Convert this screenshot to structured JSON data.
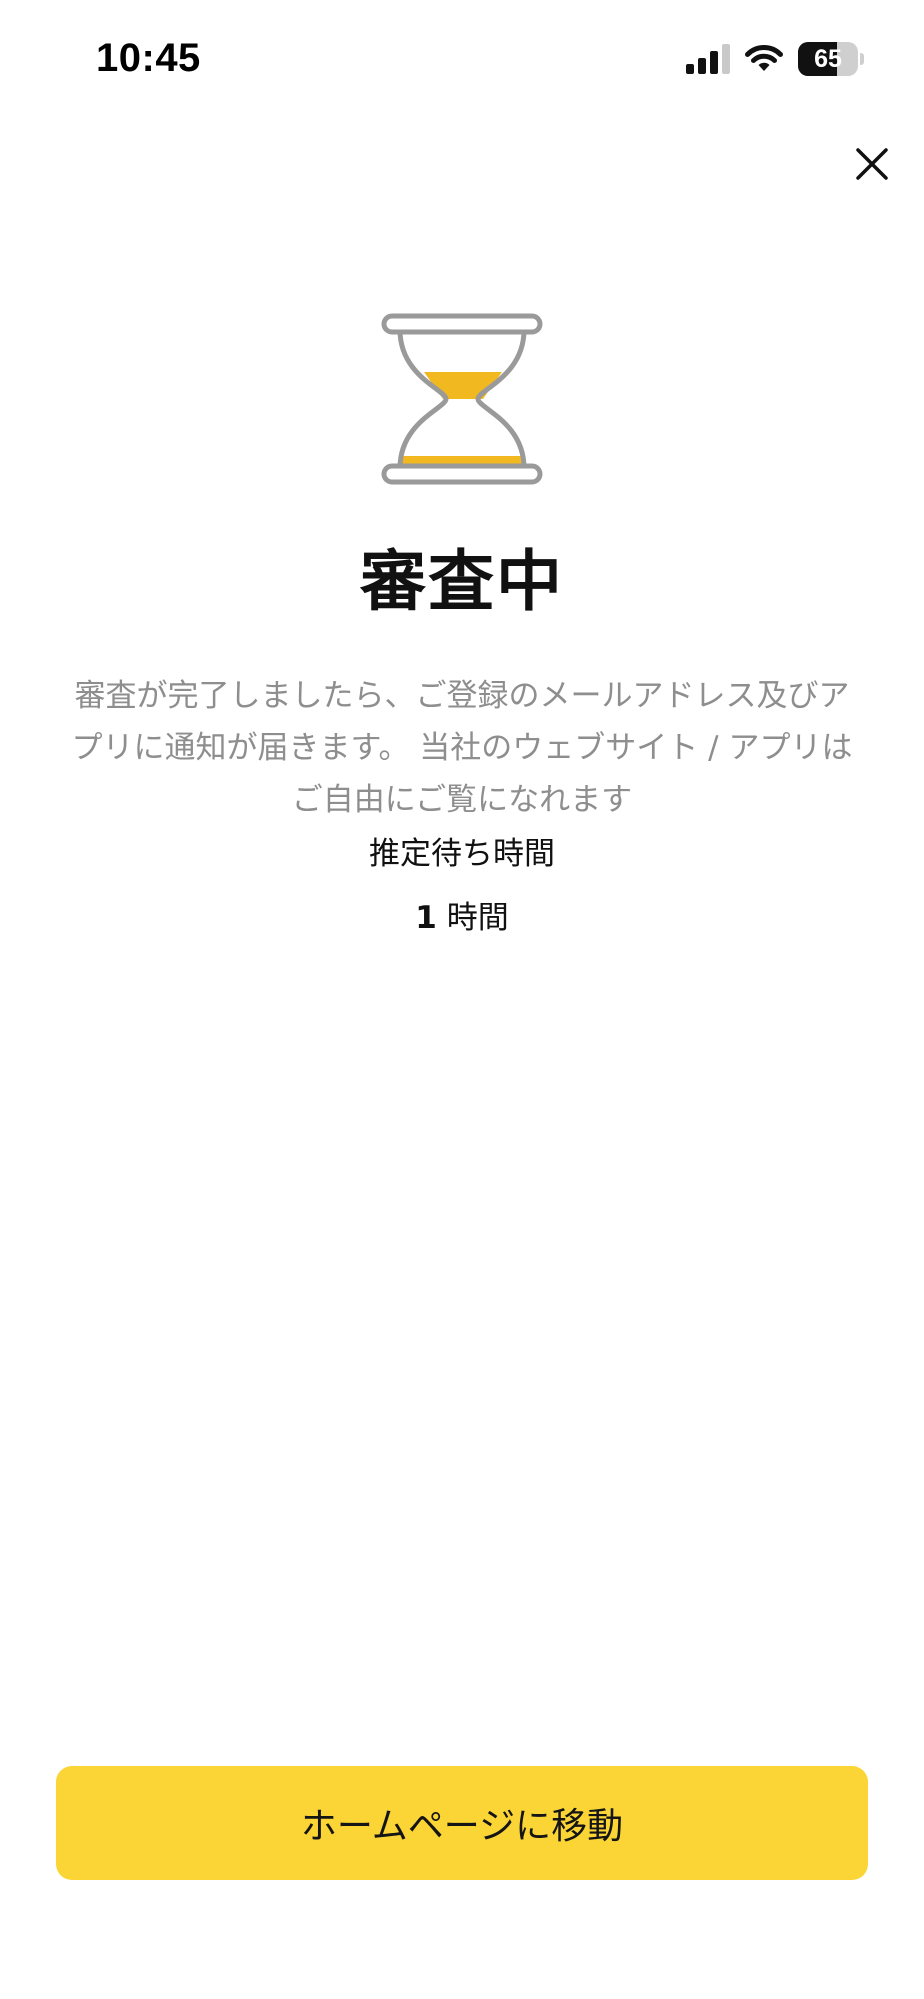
{
  "status_bar": {
    "time": "10:45",
    "battery_level": "65",
    "battery_fraction": 0.65,
    "signal_icon": "cellular-signal-icon",
    "wifi_icon": "wifi-icon"
  },
  "header": {
    "close_icon": "close-icon"
  },
  "main": {
    "illustration_icon": "hourglass-icon",
    "title": "審査中",
    "description": "審査が完了しましたら、ご登録のメールアドレス及びアプリに通知が届きます。 当社のウェブサイト / アプリはご自由にご覧になれます",
    "wait_label": "推定待ち時間",
    "wait_number": "1",
    "wait_unit": " 時間"
  },
  "footer": {
    "home_button_label": "ホームページに移動"
  },
  "colors": {
    "accent": "#fbd535",
    "sand": "#f1b820",
    "hourglass_outline": "#9a9a9a",
    "muted_text": "#8e8e8e"
  }
}
